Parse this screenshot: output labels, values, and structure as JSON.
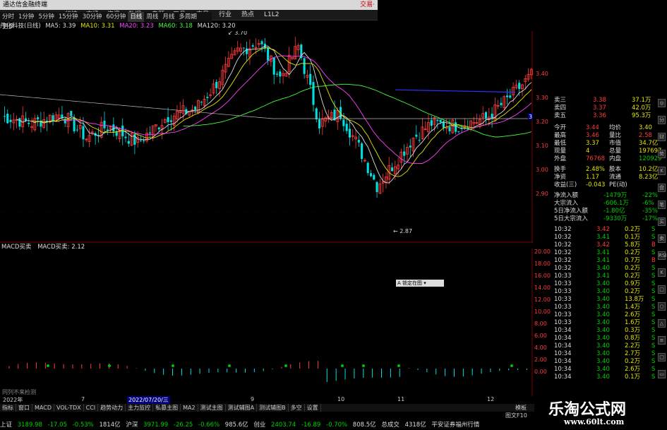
{
  "window": {
    "title": "通达信金融终端",
    "right": "交易·"
  },
  "menu": [
    "行情",
    "市场",
    "资讯",
    "数据",
    "专题",
    "工具",
    "交易",
    "行业",
    "热点",
    "L1L2"
  ],
  "periods": [
    "分时",
    "1分钟",
    "5分钟",
    "15分钟",
    "30分钟",
    "60分钟",
    "日线",
    "周线",
    "月线",
    "多周期",
    "更多"
  ],
  "active_period": "日线",
  "ma": {
    "stock": "丹化科技(日线)",
    "ma5": "MA5: 3.39",
    "ma10": "MA10: 3.31",
    "ma20": "MA20: 3.23",
    "ma60": "MA60: 3.18",
    "ma120": "MA120: 3.20"
  },
  "annotations": {
    "high": "3.70",
    "low": "2.87",
    "marker": "3.32"
  },
  "price_ticks": [
    "3.40",
    "3.30",
    "3.20",
    "3.10",
    "3.00",
    "2.90"
  ],
  "macd": {
    "title": "MACD买卖",
    "value": "MACD买卖: 2.12"
  },
  "macd_ticks": [
    "20.00",
    "18.00",
    "16.00",
    "14.00",
    "12.00",
    "10.00",
    "8.00",
    "6.00",
    "4.00",
    "2.00",
    "0.00"
  ],
  "popup": "A 锁定在图 ▾",
  "date_axis": [
    "2022年",
    "7",
    "2022/07/20/三",
    "9",
    "10",
    "11",
    "12"
  ],
  "bottom_label": "同列不来检测",
  "quote": [
    [
      "卖三",
      "3.38",
      "37.1万"
    ],
    [
      "卖四",
      "3.37",
      "42.0万"
    ],
    [
      "卖五",
      "3.36",
      "95.3万"
    ]
  ],
  "stats": [
    [
      "今开",
      "3.44",
      "均价",
      "3.40"
    ],
    [
      "最高",
      "3.46",
      "量比",
      "2.58"
    ],
    [
      "最低",
      "3.37",
      "市值",
      "34.7亿"
    ],
    [
      "现量",
      "4",
      "总量",
      "197697"
    ],
    [
      "外盘",
      "76768",
      "内盘",
      "120929"
    ],
    [
      "换手",
      "2.48%",
      "股本",
      "10.2亿"
    ],
    [
      "净资",
      "1.17",
      "流通",
      "8.23亿"
    ],
    [
      "收益(三)",
      "-0.043",
      "PE(动)",
      ""
    ]
  ],
  "flow": [
    [
      "净流入额",
      "-1479万",
      "-22%"
    ],
    [
      "大宗流入",
      "-606.1万",
      "-6%"
    ],
    [
      "5日净流入额",
      "-1.80亿",
      "-35%"
    ],
    [
      "5日大宗流入",
      "-9330万",
      "-17%"
    ]
  ],
  "ticks": [
    [
      "10:32",
      "3.42",
      "0.2万",
      "S"
    ],
    [
      "10:32",
      "3.41",
      "0.1万",
      "S"
    ],
    [
      "10:32",
      "3.42",
      "5.8万",
      "B"
    ],
    [
      "10:32",
      "3.41",
      "0.2万",
      "S"
    ],
    [
      "10:32",
      "3.41",
      "0.7万",
      "B"
    ],
    [
      "10:32",
      "3.40",
      "0.2万",
      "S"
    ],
    [
      "10:33",
      "3.41",
      "0.2万",
      "S"
    ],
    [
      "10:33",
      "3.40",
      "0.9万",
      "S"
    ],
    [
      "10:33",
      "3.40",
      "0.2万",
      "S"
    ],
    [
      "10:33",
      "3.40",
      "13.8万",
      "S"
    ],
    [
      "10:33",
      "3.40",
      "1.4万",
      "S"
    ],
    [
      "10:33",
      "3.40",
      "2.6万",
      "S"
    ],
    [
      "10:33",
      "3.40",
      "1.6万",
      "S"
    ],
    [
      "10:34",
      "3.40",
      "0.3万",
      "S"
    ],
    [
      "10:34",
      "3.40",
      "0.8万",
      "S"
    ],
    [
      "10:34",
      "3.40",
      "2.2万",
      "S"
    ],
    [
      "10:34",
      "3.40",
      "2.7万",
      "S"
    ],
    [
      "10:34",
      "3.40",
      "0.2万",
      "S"
    ],
    [
      "10:34",
      "3.40",
      "2.6万",
      "S"
    ],
    [
      "10:34",
      "3.40",
      "0.1万",
      "S"
    ]
  ],
  "tabs": [
    "指标",
    "窗口",
    "MACD",
    "VOL-TDX",
    "CCI",
    "趋势动力",
    "主力监控",
    "私募主图",
    "MA2",
    "测试主图",
    "测试辅图A",
    "测试辅图B",
    "多空",
    "设置"
  ],
  "status": {
    "sh_name": "上证",
    "sh_val": "3189.98",
    "sh_chg": "-17.05",
    "sh_pct": "-0.53%",
    "sh_amt": "1814亿",
    "sz_name": "沪深",
    "sz_val": "3971.99",
    "sz_chg": "-26.25",
    "sz_pct": "-0.66%",
    "sz_amt": "985.6亿",
    "cy_name": "创业",
    "cy_val": "2403.74",
    "cy_chg": "-16.89",
    "cy_pct": "-0.70%",
    "cy_amt": "808.5亿",
    "total": "总成交",
    "total_amt": "4318亿",
    "broker": "平安证券福州行情"
  },
  "right_bottom": {
    "label1": "图文F10",
    "label2": "模板"
  },
  "watermark": {
    "text": "乐淘公式网",
    "url": "www.60lt.com"
  },
  "side_buttons": [
    "◎",
    "分",
    "财",
    "势",
    "K",
    "盘",
    "笔",
    "买",
    "卖",
    "RSI",
    "K",
    "□",
    "○",
    "△",
    "≡",
    "□",
    "▭"
  ],
  "colors": {
    "up": "#ff3b3b",
    "down": "#00e0e0",
    "bg": "#000000",
    "grid": "#5a0000"
  }
}
